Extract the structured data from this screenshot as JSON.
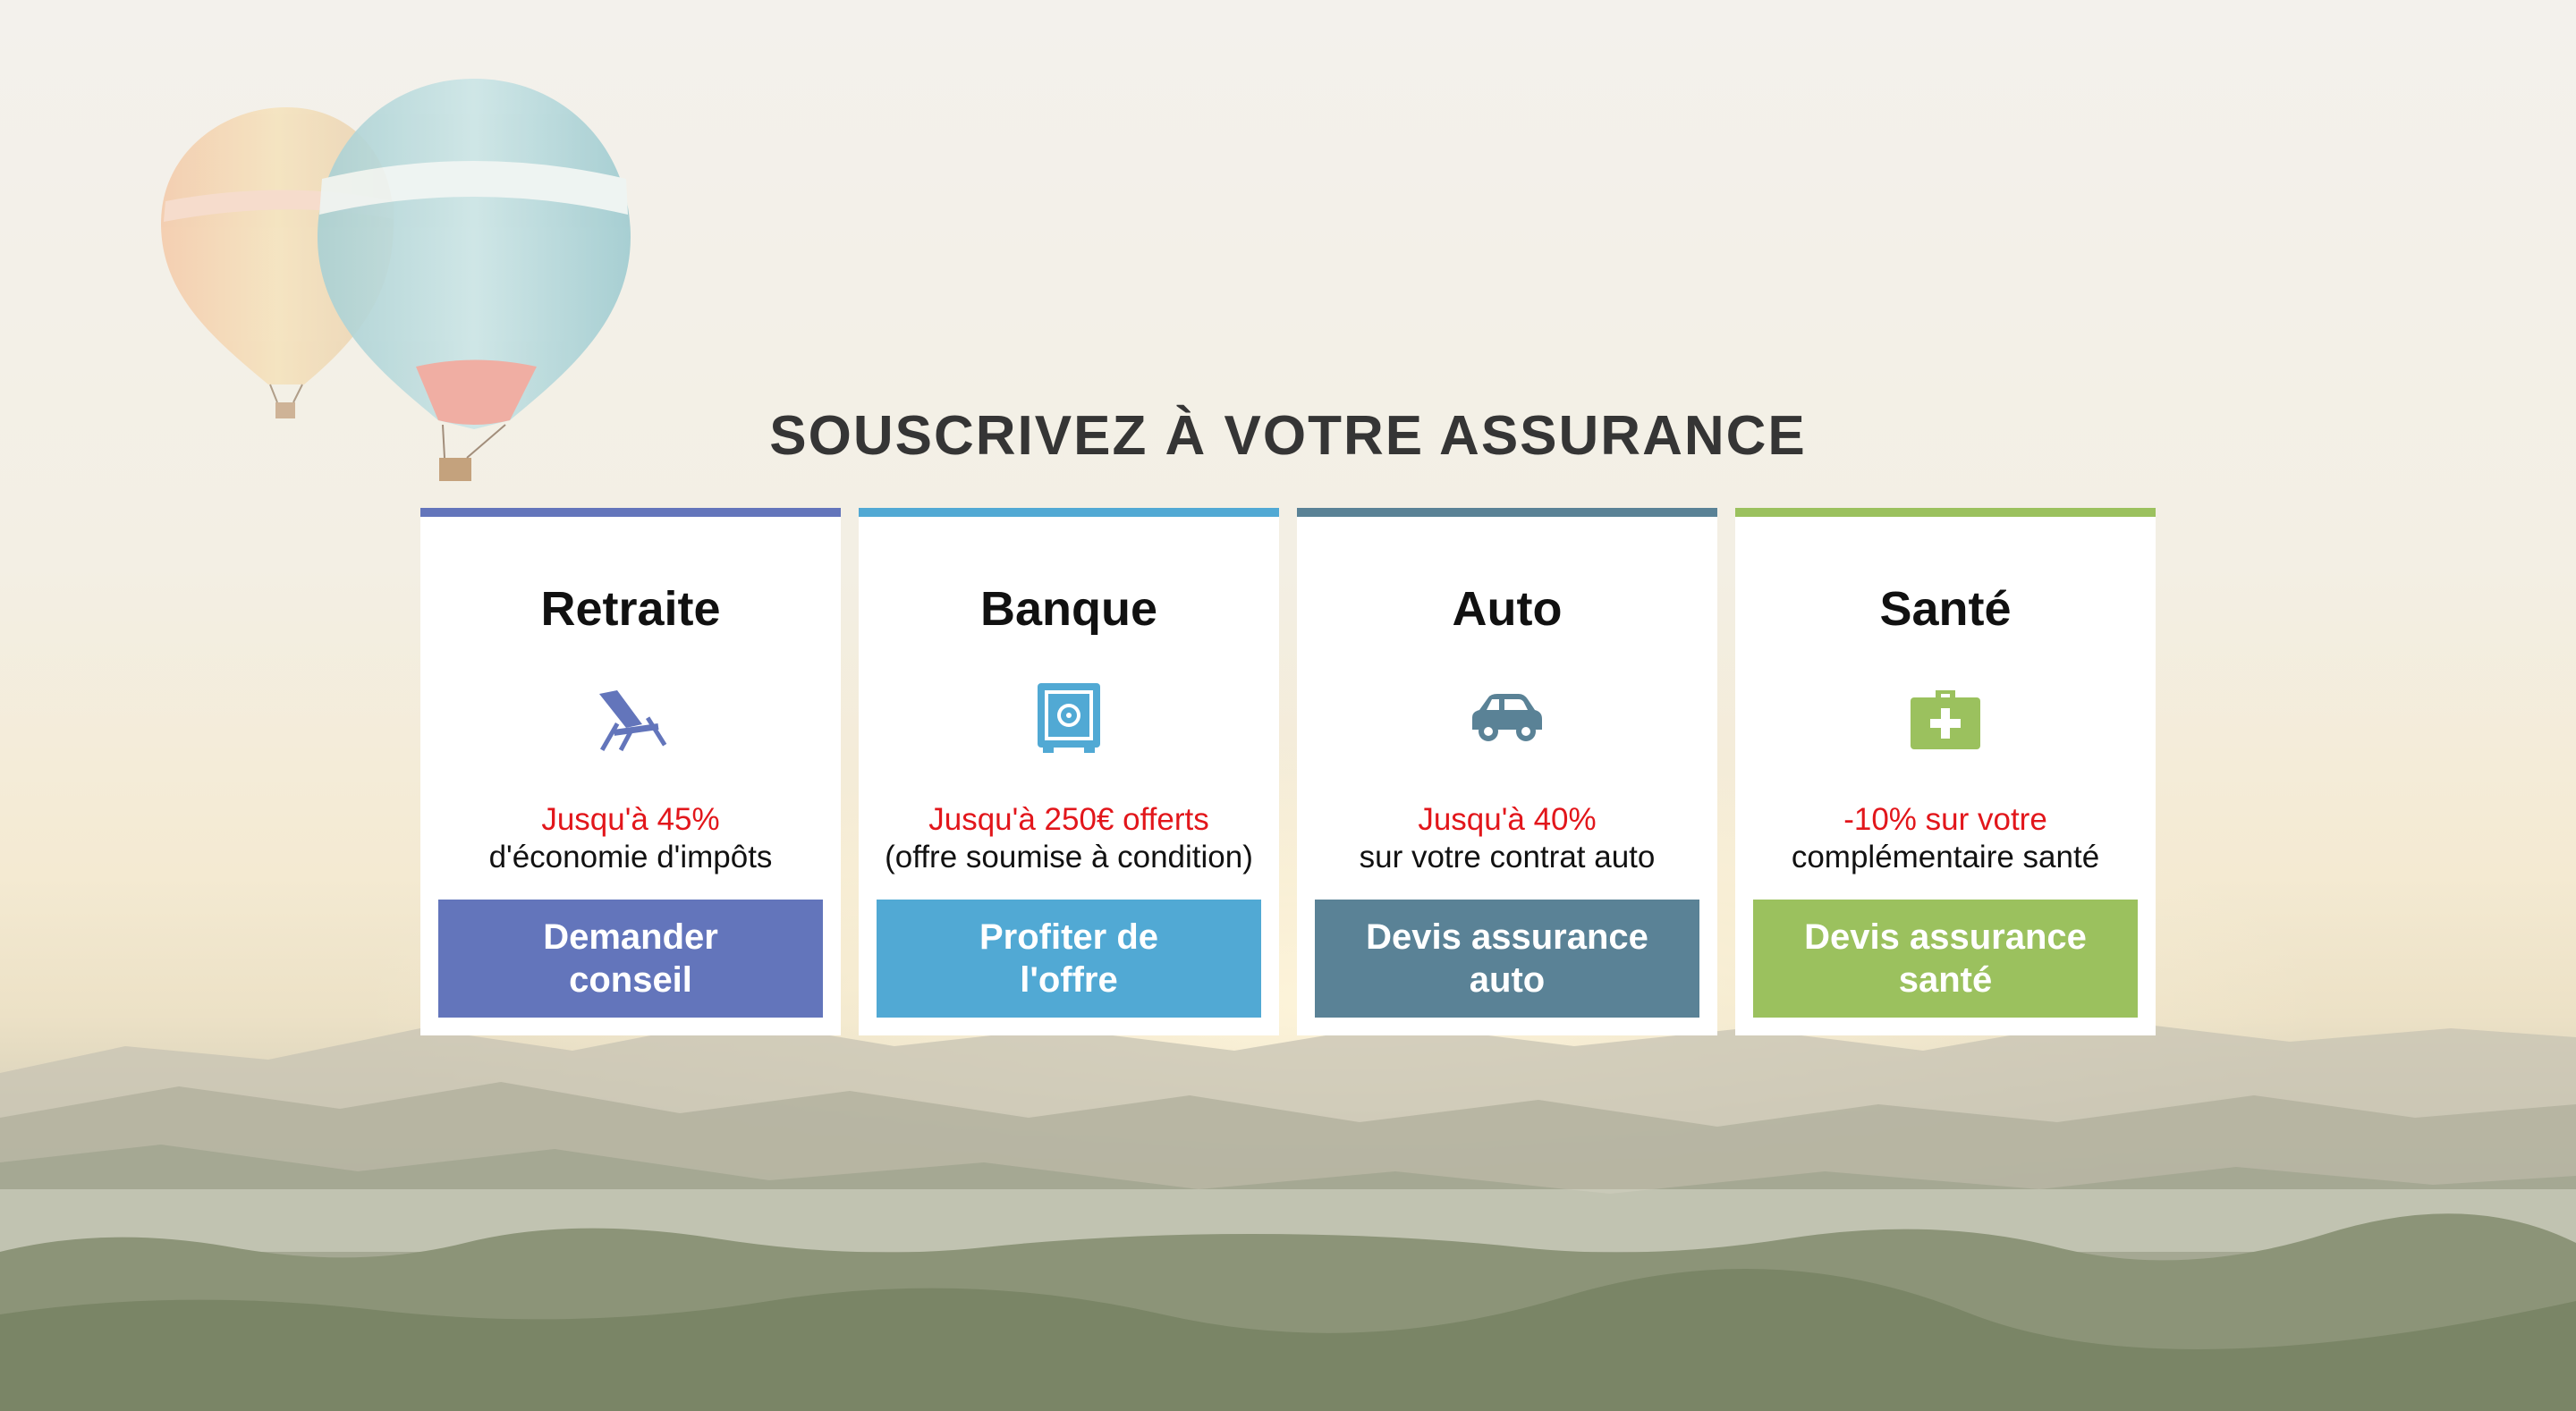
{
  "section": {
    "title": "SOUSCRIVEZ À VOTRE ASSURANCE"
  },
  "colors": {
    "retraite": "#6375bb",
    "banque": "#51a9d4",
    "auto": "#5a8296",
    "sante": "#9bc15e",
    "highlight": "#e2161b"
  },
  "cards": [
    {
      "title": "Retraite",
      "icon": "beach-chair-icon",
      "highlight": "Jusqu'à 45%",
      "subtext": "d'économie d'impôts",
      "button_line1": "Demander",
      "button_line2": "conseil"
    },
    {
      "title": "Banque",
      "icon": "safe-icon",
      "highlight": "Jusqu'à 250€ offerts",
      "subtext": "(offre soumise à condition)",
      "button_line1": "Profiter de",
      "button_line2": "l'offre"
    },
    {
      "title": "Auto",
      "icon": "car-icon",
      "highlight": "Jusqu'à 40%",
      "subtext": "sur votre contrat auto",
      "button_line1": "Devis assurance",
      "button_line2": "auto"
    },
    {
      "title": "Santé",
      "icon": "first-aid-kit-icon",
      "highlight": "-10% sur votre",
      "subtext": "complémentaire santé",
      "button_line1": "Devis assurance",
      "button_line2": "santé"
    }
  ]
}
